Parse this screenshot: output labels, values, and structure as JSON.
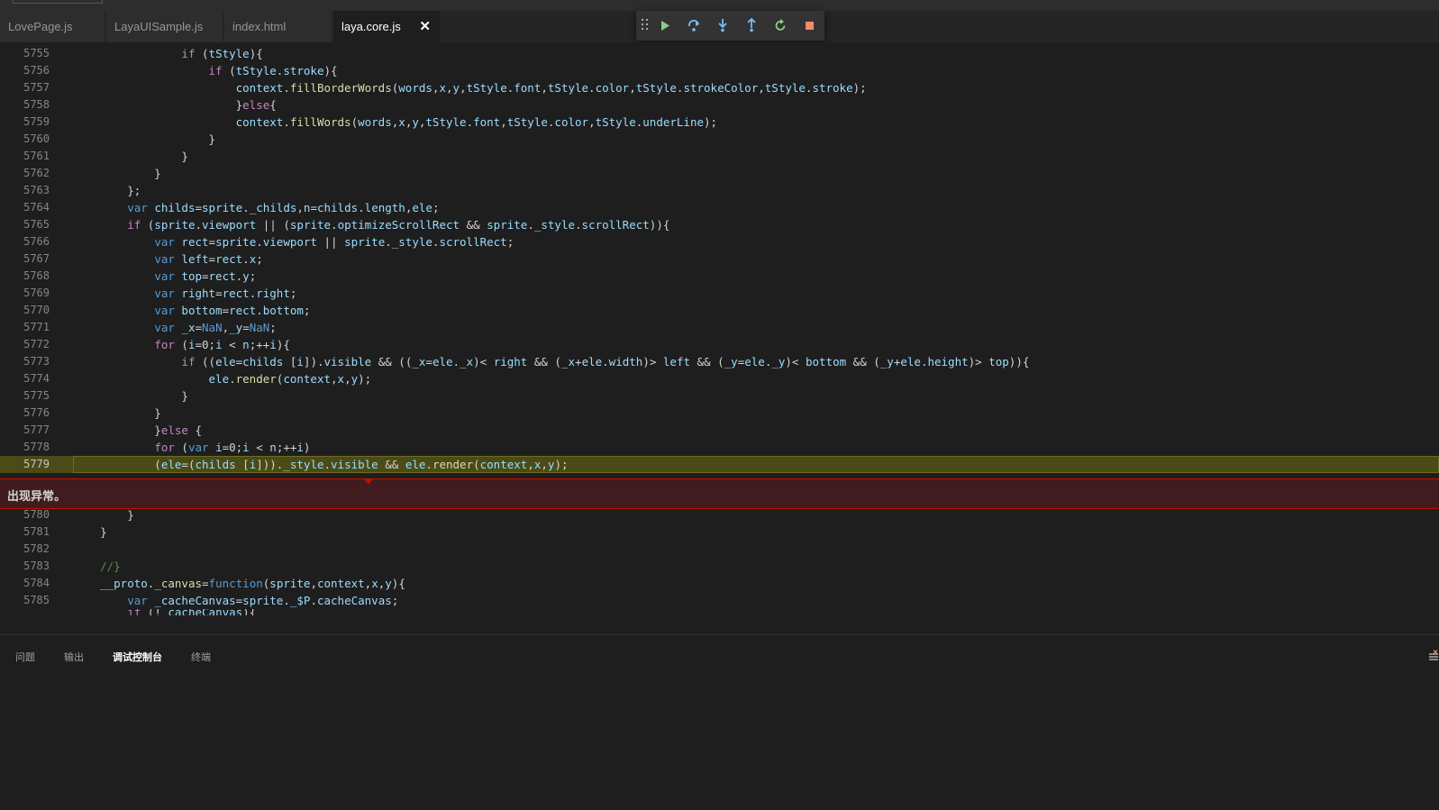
{
  "tabs": [
    {
      "label": "LovePage.js",
      "active": false
    },
    {
      "label": "LayaUISample.js",
      "active": false
    },
    {
      "label": "index.html",
      "active": false
    },
    {
      "label": "laya.core.js",
      "active": true,
      "close": "✕"
    }
  ],
  "debug_toolbar": {
    "buttons": [
      "drag-handle-icon",
      "continue-icon",
      "step-over-icon",
      "step-into-icon",
      "step-out-icon",
      "restart-icon",
      "stop-icon"
    ],
    "colors": {
      "continue": "#89d185",
      "step": "#75beff",
      "restart": "#89d185",
      "stop": "#f48771"
    }
  },
  "editor": {
    "line_numbers": [
      "5755",
      "5756",
      "5757",
      "5758",
      "5759",
      "5760",
      "5761",
      "5762",
      "5763",
      "5764",
      "5765",
      "5766",
      "5767",
      "5768",
      "5769",
      "5770",
      "5771",
      "5772",
      "5773",
      "5774",
      "5775",
      "5776",
      "5777",
      "5778",
      "5779",
      "5780",
      "5781",
      "5782",
      "5783",
      "5784",
      "5785"
    ],
    "current_line": "5779",
    "exception_message": "出现异常。"
  },
  "panel": {
    "tabs": [
      "问题",
      "输出",
      "调试控制台",
      "终端"
    ],
    "active_tab": "调试控制台"
  }
}
